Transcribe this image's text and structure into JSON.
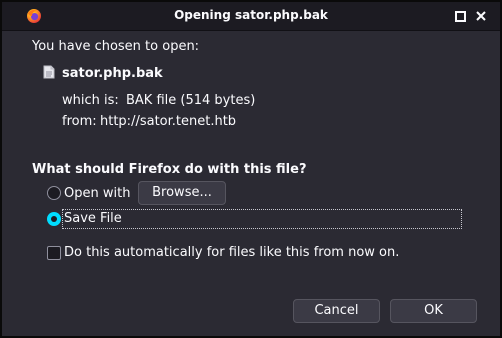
{
  "window": {
    "title": "Opening sator.php.bak",
    "app_icon": "firefox-icon",
    "controls": [
      "restore-icon",
      "close-icon"
    ]
  },
  "dialog": {
    "intro": "You have chosen to open:",
    "file_icon": "document-icon",
    "filename": "sator.php.bak",
    "which_is_label": "which is:",
    "which_is_value": "BAK file (514 bytes)",
    "from_label": "from:",
    "from_value": "http://sator.tenet.htb",
    "question": "What should Firefox do with this file?",
    "options": {
      "open_with_label": "Open with",
      "open_with_selected": false,
      "browse_label": "Browse...",
      "save_file_label": "Save File",
      "save_file_selected": true
    },
    "auto_checkbox_label": "Do this automatically for files like this from now on.",
    "auto_checkbox_checked": false
  },
  "buttons": {
    "cancel": "Cancel",
    "ok": "OK"
  },
  "colors": {
    "background": "#2b2a33",
    "titlebar": "#1c1b22",
    "text": "#fbfbfe",
    "accent": "#00ddff",
    "button": "#3b3a45"
  }
}
